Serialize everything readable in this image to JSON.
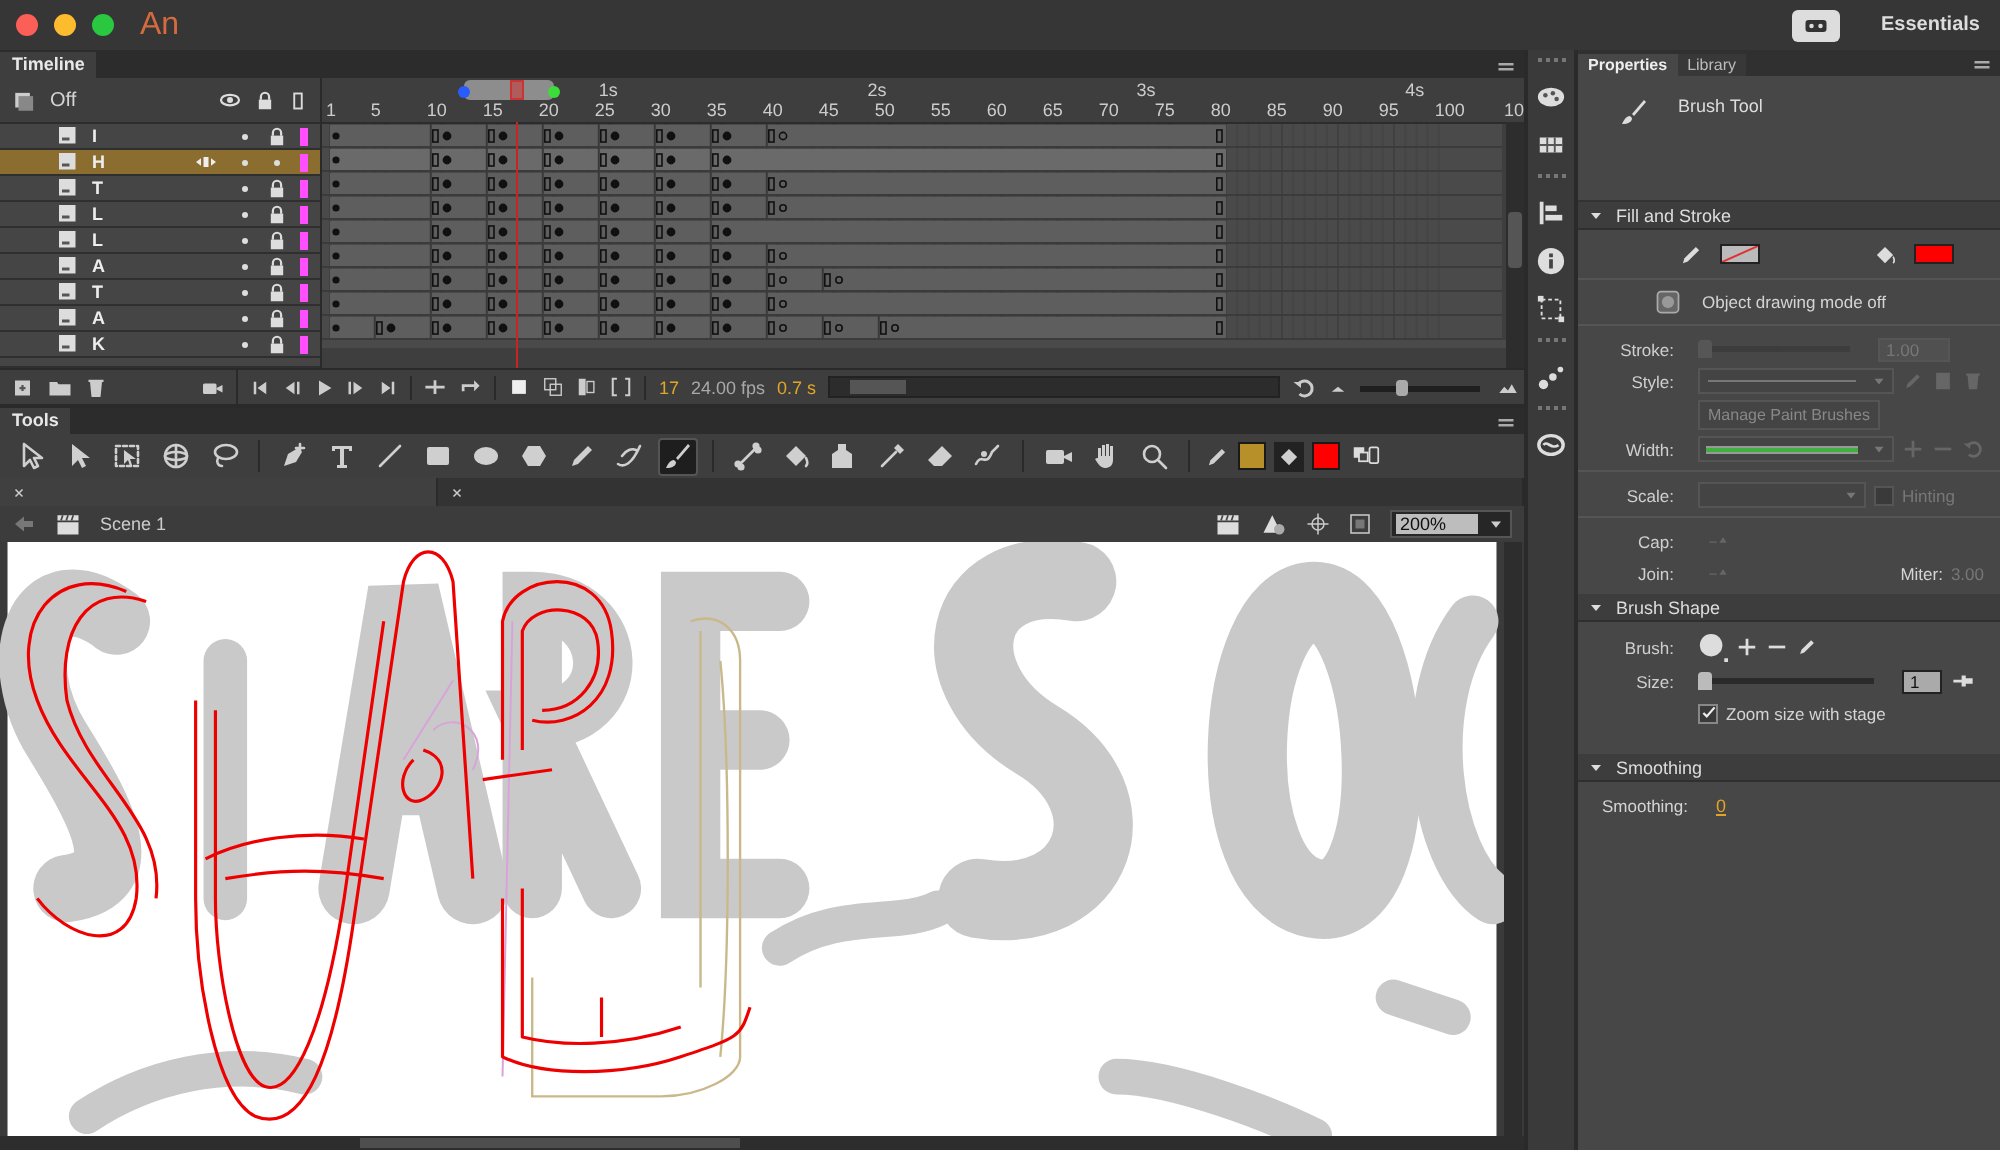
{
  "app": {
    "logo": "An",
    "workspace": "Essentials"
  },
  "timeline": {
    "tab": "Timeline",
    "onion_label": "Off",
    "ruler_labels": [
      "1",
      "5",
      "10",
      "15",
      "20",
      "25",
      "30",
      "35",
      "40",
      "45",
      "50",
      "55",
      "60",
      "65",
      "70",
      "75",
      "80",
      "85",
      "90",
      "95",
      "100",
      "10"
    ],
    "seconds": [
      "1s",
      "2s",
      "3s",
      "4s"
    ],
    "layers": [
      {
        "name": "I",
        "selected": false,
        "locked": true
      },
      {
        "name": "H",
        "selected": true,
        "locked": false
      },
      {
        "name": "T",
        "selected": false,
        "locked": true
      },
      {
        "name": "L",
        "selected": false,
        "locked": true
      },
      {
        "name": "L",
        "selected": false,
        "locked": true
      },
      {
        "name": "A",
        "selected": false,
        "locked": true
      },
      {
        "name": "T",
        "selected": false,
        "locked": true
      },
      {
        "name": "A",
        "selected": false,
        "locked": true
      },
      {
        "name": "K",
        "selected": false,
        "locked": true
      }
    ],
    "current_frame": "17",
    "fps": "24.00 fps",
    "elapsed": "0.7 s",
    "zoom_slider": {
      "level": 0.35
    }
  },
  "tools": {
    "tab": "Tools",
    "items": [
      {
        "kind": "selection",
        "selected": false
      },
      {
        "kind": "subselection",
        "selected": false
      },
      {
        "kind": "transform",
        "selected": false
      },
      {
        "kind": "rotate3d",
        "selected": false
      },
      {
        "kind": "lasso",
        "selected": false
      },
      {
        "kind": "pen",
        "selected": false
      },
      {
        "kind": "text",
        "selected": false
      },
      {
        "kind": "line",
        "selected": false
      },
      {
        "kind": "rectangle",
        "selected": false
      },
      {
        "kind": "oval",
        "selected": false
      },
      {
        "kind": "polystar",
        "selected": false
      },
      {
        "kind": "pencil",
        "selected": false
      },
      {
        "kind": "paintbrush",
        "selected": false
      },
      {
        "kind": "brush",
        "selected": true
      },
      {
        "kind": "bone",
        "selected": false
      },
      {
        "kind": "bucket",
        "selected": false
      },
      {
        "kind": "inkbottle",
        "selected": false
      },
      {
        "kind": "eyedropper",
        "selected": false
      },
      {
        "kind": "eraser",
        "selected": false
      },
      {
        "kind": "width",
        "selected": false
      },
      {
        "kind": "camera",
        "selected": false
      },
      {
        "kind": "hand",
        "selected": false
      },
      {
        "kind": "zoom",
        "selected": false
      }
    ],
    "stroke_swatch": {
      "color": "#b8902a"
    },
    "fill_swatch": {
      "color": "#ff0000"
    }
  },
  "stage": {
    "scene": "Scene 1",
    "zoom": "200%"
  },
  "properties": {
    "tabs": [
      {
        "label": "Properties",
        "selected": true
      },
      {
        "label": "Library",
        "selected": false
      }
    ],
    "tool_name": "Brush Tool",
    "fill_and_stroke": {
      "title": "Fill and Stroke",
      "expanded": true,
      "fill_swatch": {
        "color": "#ff0000"
      },
      "object_drawing": "Object drawing mode off",
      "stroke": {
        "label": "Stroke:",
        "value": "1.00",
        "level": 0,
        "disabled": true
      },
      "style_label": "Style:",
      "manage_button": {
        "label": "Manage Paint Brushes",
        "disabled": true
      },
      "width_label": "Width:",
      "scale_label": "Scale:",
      "hinting": {
        "label": "Hinting",
        "checked": false
      },
      "cap_label": "Cap:",
      "join_label": "Join:",
      "miter_label": "Miter:",
      "miter_value": "3.00"
    },
    "brush_shape": {
      "title": "Brush Shape",
      "expanded": true,
      "brush_label": "Brush:",
      "size_label": "Size:",
      "size_value": "1",
      "size_slider": {
        "level": 0
      },
      "zoom_with_stage": {
        "label": "Zoom size with stage",
        "checked": true
      }
    },
    "smoothing": {
      "title": "Smoothing",
      "expanded": true,
      "label": "Smoothing:",
      "value": "0"
    }
  }
}
